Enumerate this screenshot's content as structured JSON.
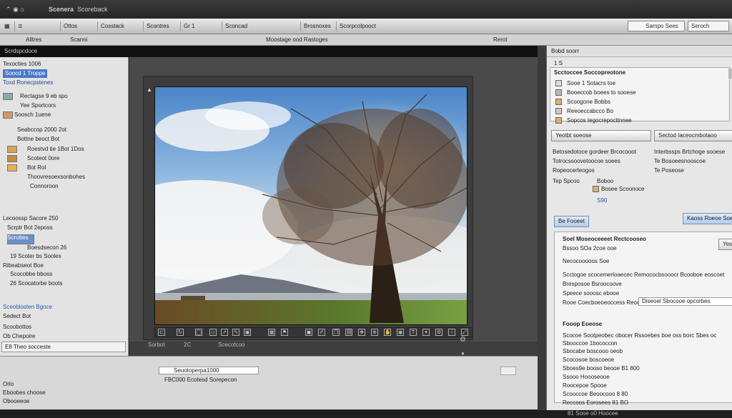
{
  "titlebar": {
    "app_title": "Scenera",
    "window_label": "Scoreback"
  },
  "toolbar": {
    "items": [
      "Ottos",
      "Cosstack",
      "Scontres",
      "Sconcad",
      "Brosnoxes",
      "Scorpcolpooct"
    ],
    "field_left": "Gr 1",
    "field_right": "Sampo Sees",
    "search_placeholder": "Seroch"
  },
  "subbar": {
    "left_a": "Alltres",
    "left_b": "Scanni",
    "center": "Moostage ood Rastoges",
    "right": "Rerot"
  },
  "left_panel": {
    "header": "Scrdspcdoce",
    "tree": [
      "Texocties 1006",
      "Soocd 1 Troppe",
      "Toxd Ronecpstenes",
      "Rectagse 9 eb spo",
      "Yee Sportcors",
      "Soosch 1uene",
      "Seabccop 2000 2ot",
      "Bottne beoct Bot",
      "Roestvd tie 1Bot 1Dos",
      "Scoteot 0ore",
      "Bot Rol",
      "Thoovresoexsonbohes",
      "Connoroon"
    ],
    "section2_header": "Lecoossp Sacore 250",
    "tree2": [
      "Scrptr Bot 2eposs",
      "Scrottes",
      "Boesdsecon 26",
      "19 Scoter bs Sooles",
      "Ribeabseot Boe",
      "Scocobbe bboss",
      "26 Scocatorbe boots"
    ],
    "link": "Sceoblosten Bgoce",
    "items3": [
      "Sedect Bot",
      "Scoobottos",
      "Ob Chepoire"
    ],
    "status": "E8 Theo socceste"
  },
  "canvas": {
    "status_left": "Sorbot",
    "status_num": "2C",
    "status_mid": "Scecotcoo"
  },
  "bottom": {
    "field1": "Seuotoperpa1000",
    "field2": "FBC000 Ecotesd Sorepecon",
    "items": [
      "Orlo",
      "Eboobes choose",
      "Obooeeoe"
    ]
  },
  "right_panel": {
    "header": "Bobd soorr",
    "row1": "1  S",
    "title": "Scctoccee Soccopreotone",
    "list": [
      "Sooe 1 Sotacrs toe",
      "Booeccob boees to sooese",
      "Scoogone Bobbs",
      "Reeoeccabcco Bo",
      "Sopcos tegocrepocttnnee"
    ],
    "tab_left": "Yeotbt soeose",
    "tab_right": "Sectod Iaceocmbotaoo",
    "desc_left": [
      "Betosedotoce gordeer Brcocooot",
      "Totrocssoovetoocoe soees",
      "Ropeocerteogos"
    ],
    "desc_right": [
      "Interbssps Brtchoge sooese",
      "Te Bosoeesnooscoe",
      "Te Poseose"
    ],
    "meta": [
      "Tep Spcoo",
      "Boboo",
      "Bosee Scoonoce"
    ],
    "btn_left": "Be Fooeet",
    "btn_right": "Kaoss Roeoe Soe",
    "section2_title": "Soel Moseoceeeet Rectcooseo",
    "price": "S90",
    "section2_sub": "Bssoo SOa 2coe ooe",
    "tag": "Yes",
    "sub_title": "Necocooooos Soe",
    "lines": [
      "Scctogoe scocemerloaecec Remococbsooocr Bcooboe eoscoet",
      "Bresposoe Bsroocoove",
      "Speece sooosc ebooe",
      "Rooe Coecboeoeoccess Reoce"
    ],
    "select_value": "Diseoel Sbocooe opcorbes",
    "section3_title": "Fooop Eoeose",
    "lines3": [
      "Scocoe Sootpeobec obocer Rssoebes boe oss borc Sbes oc",
      "Sbooccoe 1bococcon",
      "Sbocabe boscooo oeob",
      "Scocosoe boscoeoe",
      "Sboes9e booso beooe B1 800",
      "Ssooo Hoooseooe",
      "Roocepoe Spooe",
      "Reccoos Eorosees 81 BO",
      "Scooccoe Beoocooo 8 80"
    ],
    "footer": "81 Sooe o0 Hoocee"
  },
  "colors": {
    "accent": "#3a6fc4",
    "panel": "#e3e3e3",
    "dark": "#2e2e2e"
  }
}
